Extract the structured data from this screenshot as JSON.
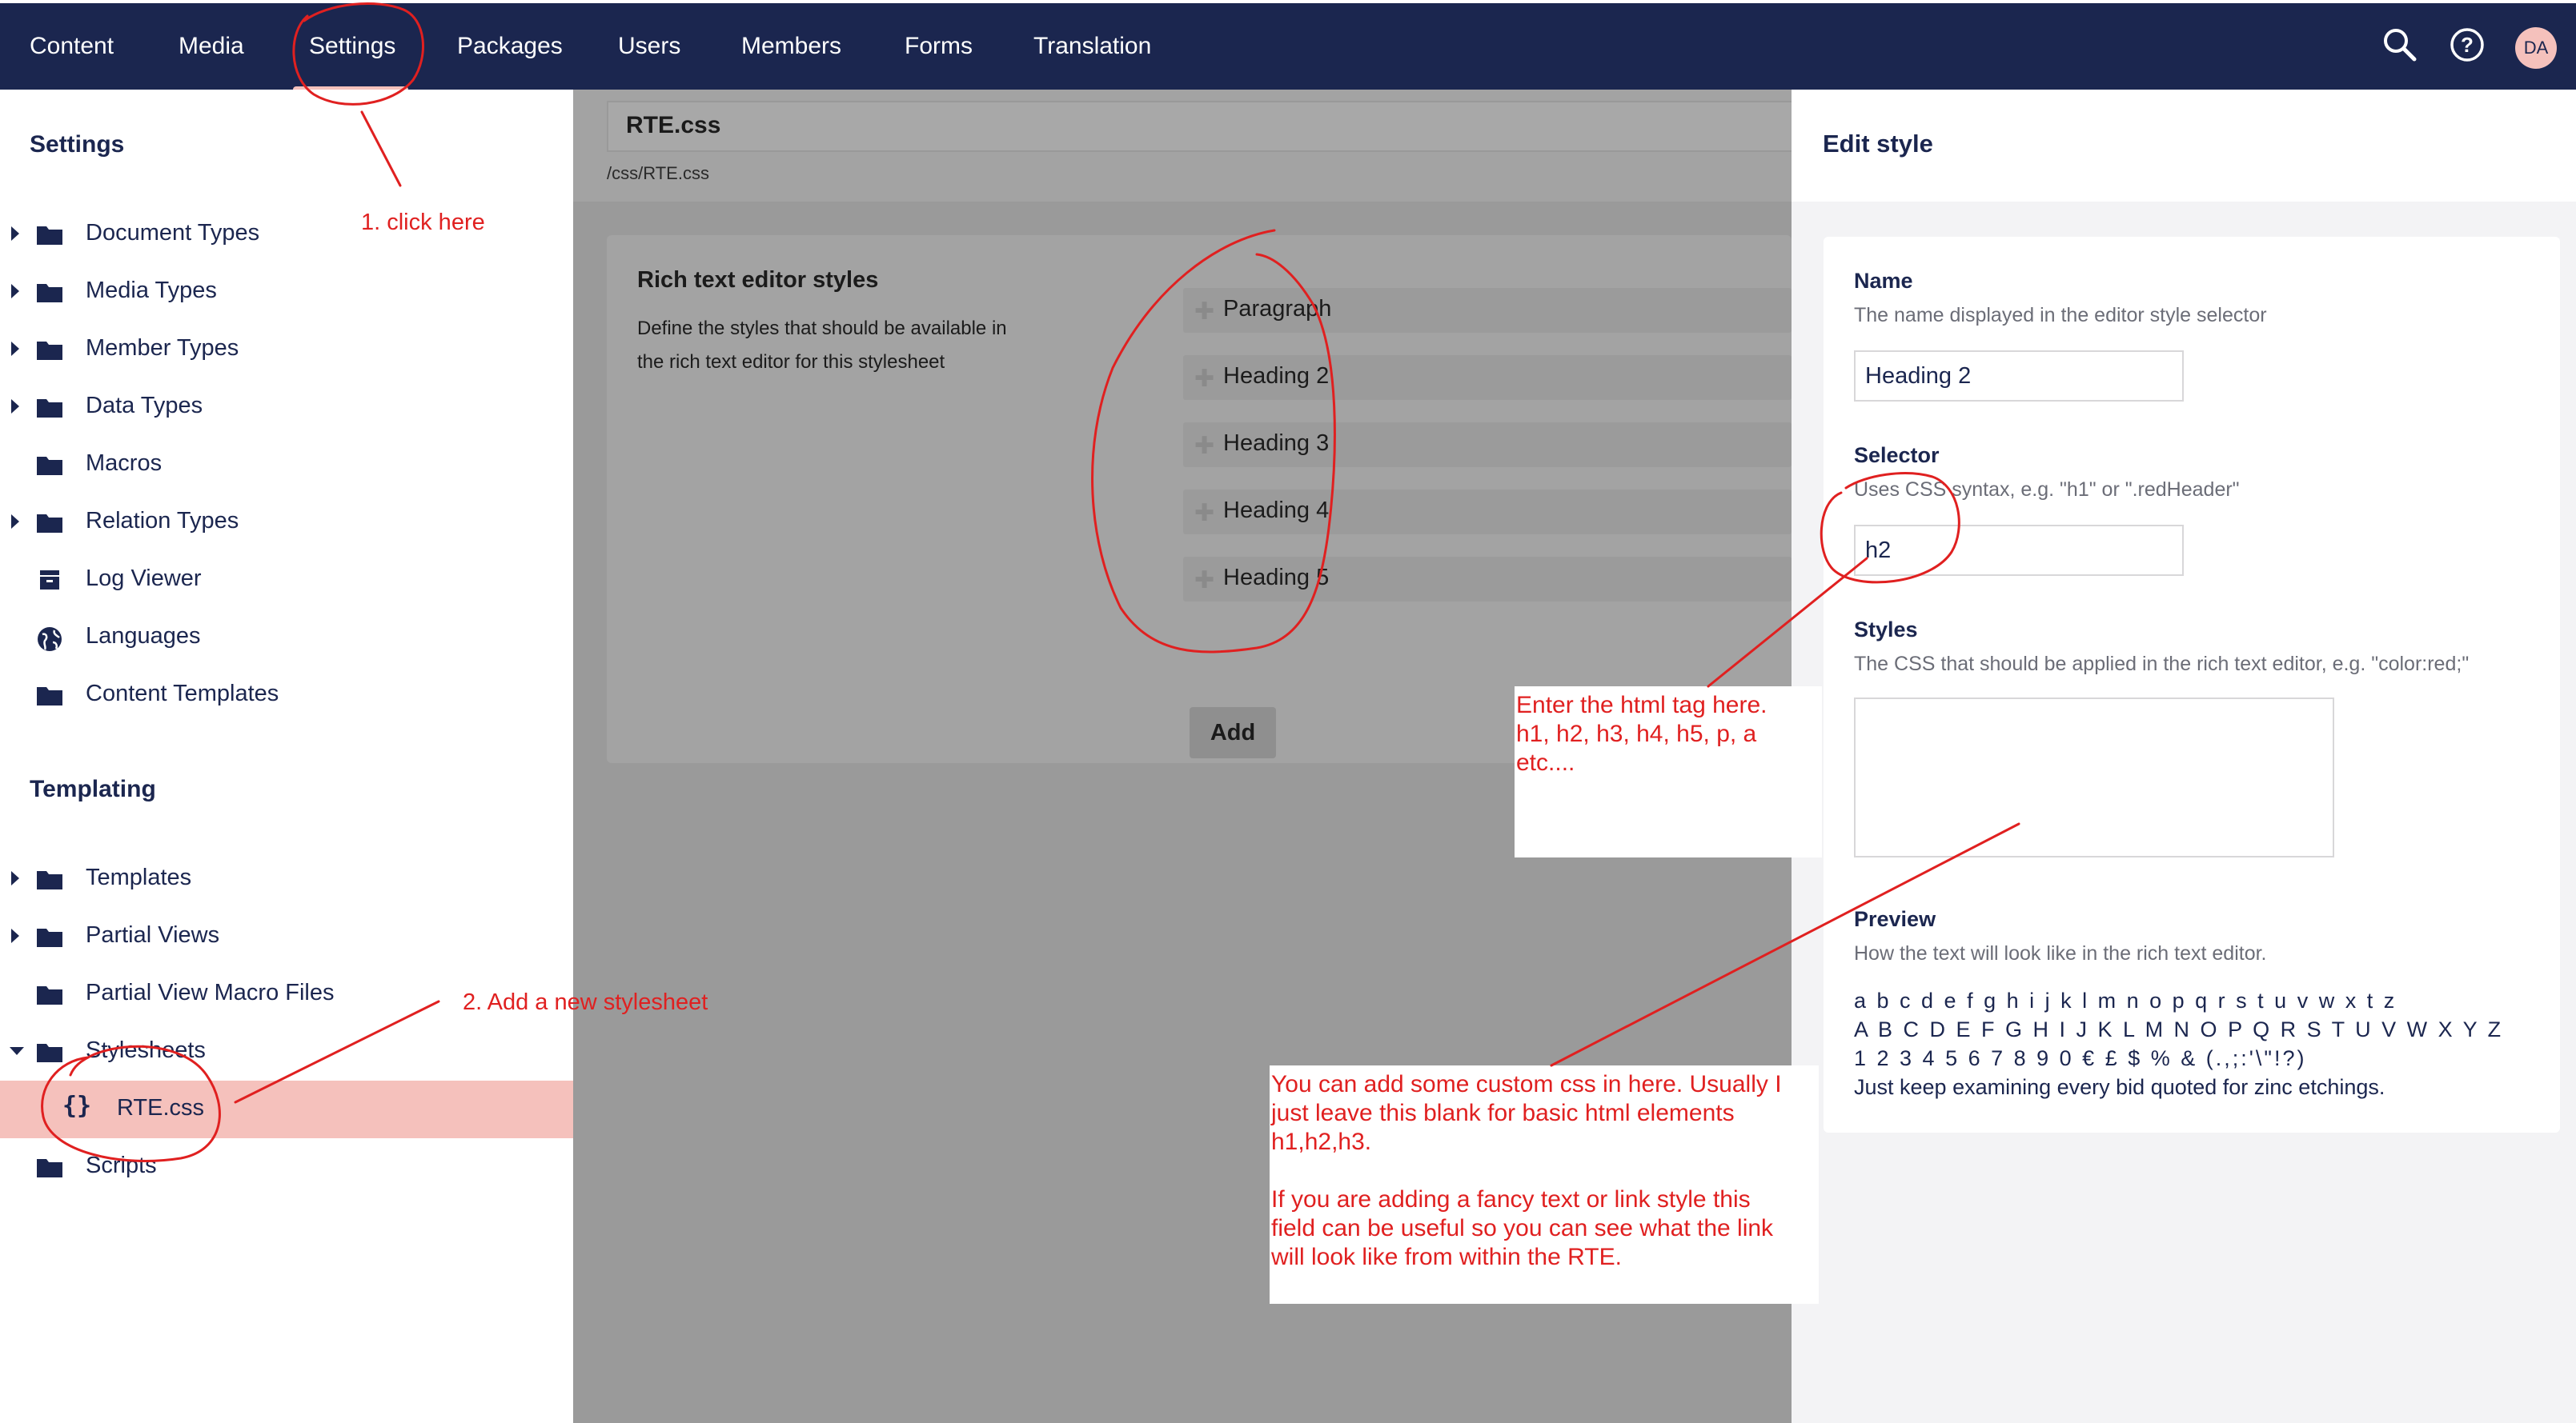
{
  "nav": {
    "items": [
      "Content",
      "Media",
      "Settings",
      "Packages",
      "Users",
      "Members",
      "Forms",
      "Translation"
    ],
    "active": "Settings",
    "avatar_initials": "DA",
    "icons": [
      "search-icon",
      "help-icon"
    ]
  },
  "sidebar": {
    "settings_heading": "Settings",
    "settings_items": [
      {
        "label": "Document Types",
        "icon": "folder-icon",
        "expandable": true
      },
      {
        "label": "Media Types",
        "icon": "folder-icon",
        "expandable": true
      },
      {
        "label": "Member Types",
        "icon": "folder-icon",
        "expandable": true
      },
      {
        "label": "Data Types",
        "icon": "folder-icon",
        "expandable": true
      },
      {
        "label": "Macros",
        "icon": "folder-icon",
        "expandable": false
      },
      {
        "label": "Relation Types",
        "icon": "folder-icon",
        "expandable": true
      },
      {
        "label": "Log Viewer",
        "icon": "archive-icon",
        "expandable": false
      },
      {
        "label": "Languages",
        "icon": "globe-icon",
        "expandable": false
      },
      {
        "label": "Content Templates",
        "icon": "folder-icon",
        "expandable": false
      }
    ],
    "templating_heading": "Templating",
    "templating_items": [
      {
        "label": "Templates",
        "icon": "folder-icon",
        "expandable": true
      },
      {
        "label": "Partial Views",
        "icon": "folder-icon",
        "expandable": true
      },
      {
        "label": "Partial View Macro Files",
        "icon": "folder-icon",
        "expandable": false
      },
      {
        "label": "Stylesheets",
        "icon": "folder-icon",
        "expanded": true
      },
      {
        "label": "RTE.css",
        "icon": "braces-icon",
        "selected": true
      },
      {
        "label": "Scripts",
        "icon": "folder-icon",
        "expandable": false
      }
    ]
  },
  "editor": {
    "file_name": "RTE.css",
    "file_path": "/css/RTE.css",
    "panel_title": "Rich text editor styles",
    "panel_description": "Define the styles that should be available in the rich text editor for this stylesheet",
    "styles": [
      "Paragraph",
      "Heading 2",
      "Heading 3",
      "Heading 4",
      "Heading 5"
    ],
    "add_label": "Add"
  },
  "edit_style": {
    "title": "Edit style",
    "name_label": "Name",
    "name_desc": "The name displayed in the editor style selector",
    "name_value": "Heading 2",
    "selector_label": "Selector",
    "selector_desc": "Uses CSS syntax, e.g. \"h1\" or \".redHeader\"",
    "selector_value": "h2",
    "styles_label": "Styles",
    "styles_desc": "The CSS that should be applied in the rich text editor, e.g. \"color:red;\"",
    "styles_value": "",
    "preview_label": "Preview",
    "preview_desc": "How the text will look like in the rich text editor.",
    "preview_lines": [
      "a b c d e f g h i j k l m n o p q r s t u v w x t z",
      "A B C D E F G H I J K L M N O P Q R S T U V W X Y Z",
      "1 2 3 4 5 6 7 8 9 0 € £ $ % & (.,;:'\\\"!?)",
      "Just keep examining every bid quoted for zinc etchings."
    ]
  },
  "annotations": {
    "step1": "1. click here",
    "step2": "2. Add a new stylesheet",
    "selector_note": [
      "Enter the html tag here.",
      "h1, h2, h3, h4, h5, p, a",
      "etc...."
    ],
    "styles_note": [
      "You can add some custom css in here. Usually I",
      "just leave this blank for basic html elements",
      "h1,h2,h3.",
      "",
      "If you are adding a fancy text or link style this",
      "field can be useful so you can see what the link",
      "will look like from within the RTE."
    ],
    "color": "#e02020"
  },
  "colors": {
    "nav_bg": "#1b264f",
    "accent": "#f5c1bc",
    "overlay": "#9a9a9a"
  }
}
